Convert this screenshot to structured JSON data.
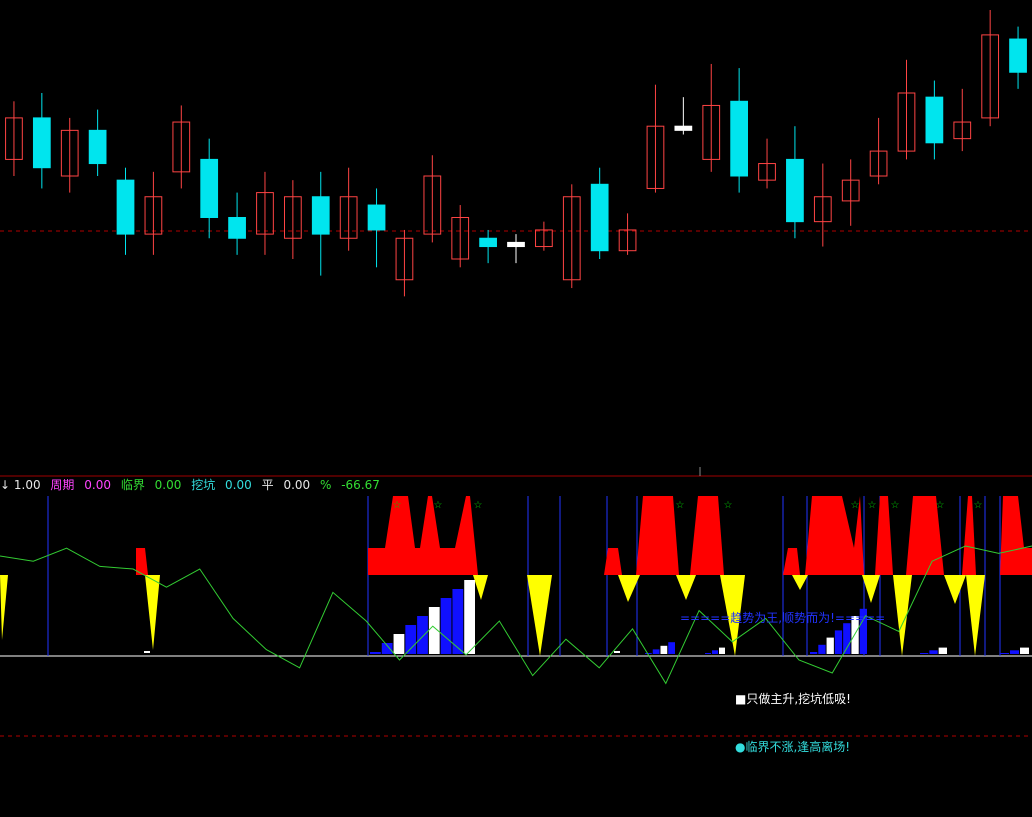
{
  "colors": {
    "background": "#000000",
    "up_candle": "#ff4444",
    "down_candle": "#00e5ee",
    "doji": "#ffffff",
    "divider": "#a00000",
    "ref_line": "#b00000",
    "green_line": "#33cc33",
    "yellow": "#ffff00",
    "red": "#ff0000",
    "blue_line": "#2233ff",
    "blue_bar": "#1010ff",
    "white_line": "#ffffff",
    "star": "#00cc00"
  },
  "legend": [
    {
      "label": "↓ 1.00",
      "color": "#e6e6e6"
    },
    {
      "label": "周期",
      "color": "#ff44ff"
    },
    {
      "label": "0.00",
      "color": "#ff44ff"
    },
    {
      "label": "临界",
      "color": "#33dd33"
    },
    {
      "label": "0.00",
      "color": "#33dd33"
    },
    {
      "label": "挖坑",
      "color": "#33dddd"
    },
    {
      "label": "0.00",
      "color": "#33dddd"
    },
    {
      "label": "平",
      "color": "#e6e6e6"
    },
    {
      "label": "0.00",
      "color": "#e6e6e6"
    },
    {
      "label": "%",
      "color": "#33dd33"
    },
    {
      "label": "-66.67",
      "color": "#33dd33"
    }
  ],
  "notes": {
    "trend": "=====趋势为王,顺势而为!=====",
    "main_rise": "■只做主升,挖坑低吸!",
    "critical": "●临界不涨,逢高离场!"
  },
  "chart_data": [
    {
      "type": "candlestick",
      "title": "",
      "candles": [
        {
          "o": 0.64,
          "c": 0.74,
          "h": 0.78,
          "l": 0.6
        },
        {
          "o": 0.74,
          "c": 0.62,
          "h": 0.8,
          "l": 0.57
        },
        {
          "o": 0.6,
          "c": 0.71,
          "h": 0.74,
          "l": 0.56
        },
        {
          "o": 0.71,
          "c": 0.63,
          "h": 0.76,
          "l": 0.6
        },
        {
          "o": 0.59,
          "c": 0.46,
          "h": 0.62,
          "l": 0.41
        },
        {
          "o": 0.46,
          "c": 0.55,
          "h": 0.61,
          "l": 0.41
        },
        {
          "o": 0.61,
          "c": 0.73,
          "h": 0.77,
          "l": 0.57
        },
        {
          "o": 0.64,
          "c": 0.5,
          "h": 0.69,
          "l": 0.45
        },
        {
          "o": 0.5,
          "c": 0.45,
          "h": 0.56,
          "l": 0.41
        },
        {
          "o": 0.46,
          "c": 0.56,
          "h": 0.61,
          "l": 0.41
        },
        {
          "o": 0.45,
          "c": 0.55,
          "h": 0.59,
          "l": 0.4
        },
        {
          "o": 0.55,
          "c": 0.46,
          "h": 0.61,
          "l": 0.36
        },
        {
          "o": 0.45,
          "c": 0.55,
          "h": 0.62,
          "l": 0.42
        },
        {
          "o": 0.53,
          "c": 0.47,
          "h": 0.57,
          "l": 0.38
        },
        {
          "o": 0.35,
          "c": 0.45,
          "h": 0.47,
          "l": 0.31
        },
        {
          "o": 0.46,
          "c": 0.6,
          "h": 0.65,
          "l": 0.44
        },
        {
          "o": 0.4,
          "c": 0.5,
          "h": 0.53,
          "l": 0.38
        },
        {
          "o": 0.45,
          "c": 0.43,
          "h": 0.47,
          "l": 0.39
        },
        {
          "o": 0.44,
          "c": 0.43,
          "h": 0.46,
          "l": 0.39
        },
        {
          "o": 0.43,
          "c": 0.47,
          "h": 0.49,
          "l": 0.42
        },
        {
          "o": 0.35,
          "c": 0.55,
          "h": 0.58,
          "l": 0.33
        },
        {
          "o": 0.58,
          "c": 0.42,
          "h": 0.62,
          "l": 0.4
        },
        {
          "o": 0.42,
          "c": 0.47,
          "h": 0.51,
          "l": 0.41
        },
        {
          "o": 0.57,
          "c": 0.72,
          "h": 0.82,
          "l": 0.56
        },
        {
          "o": 0.72,
          "c": 0.71,
          "h": 0.79,
          "l": 0.7
        },
        {
          "o": 0.64,
          "c": 0.77,
          "h": 0.87,
          "l": 0.61
        },
        {
          "o": 0.78,
          "c": 0.6,
          "h": 0.86,
          "l": 0.56
        },
        {
          "o": 0.59,
          "c": 0.63,
          "h": 0.69,
          "l": 0.57
        },
        {
          "o": 0.64,
          "c": 0.49,
          "h": 0.72,
          "l": 0.45
        },
        {
          "o": 0.49,
          "c": 0.55,
          "h": 0.63,
          "l": 0.43
        },
        {
          "o": 0.54,
          "c": 0.59,
          "h": 0.64,
          "l": 0.48
        },
        {
          "o": 0.6,
          "c": 0.66,
          "h": 0.74,
          "l": 0.58
        },
        {
          "o": 0.66,
          "c": 0.8,
          "h": 0.88,
          "l": 0.64
        },
        {
          "o": 0.79,
          "c": 0.68,
          "h": 0.83,
          "l": 0.64
        },
        {
          "o": 0.69,
          "c": 0.73,
          "h": 0.81,
          "l": 0.66
        },
        {
          "o": 0.74,
          "c": 0.94,
          "h": 1.0,
          "l": 0.72
        },
        {
          "o": 0.93,
          "c": 0.85,
          "h": 0.96,
          "l": 0.81
        }
      ]
    },
    {
      "type": "line",
      "title": "",
      "series": [
        {
          "values": [
            0.5,
            0.52,
            0.47,
            0.54,
            0.55,
            0.62,
            0.55,
            0.74,
            0.86,
            0.93,
            0.64,
            0.75,
            0.9,
            0.77,
            0.88,
            0.75,
            0.96,
            0.82,
            0.93,
            0.78,
            0.99,
            0.71,
            0.83,
            0.74,
            0.9,
            0.95,
            0.73,
            0.79,
            0.52,
            0.45,
            0.49,
            0.4
          ]
        }
      ]
    }
  ]
}
